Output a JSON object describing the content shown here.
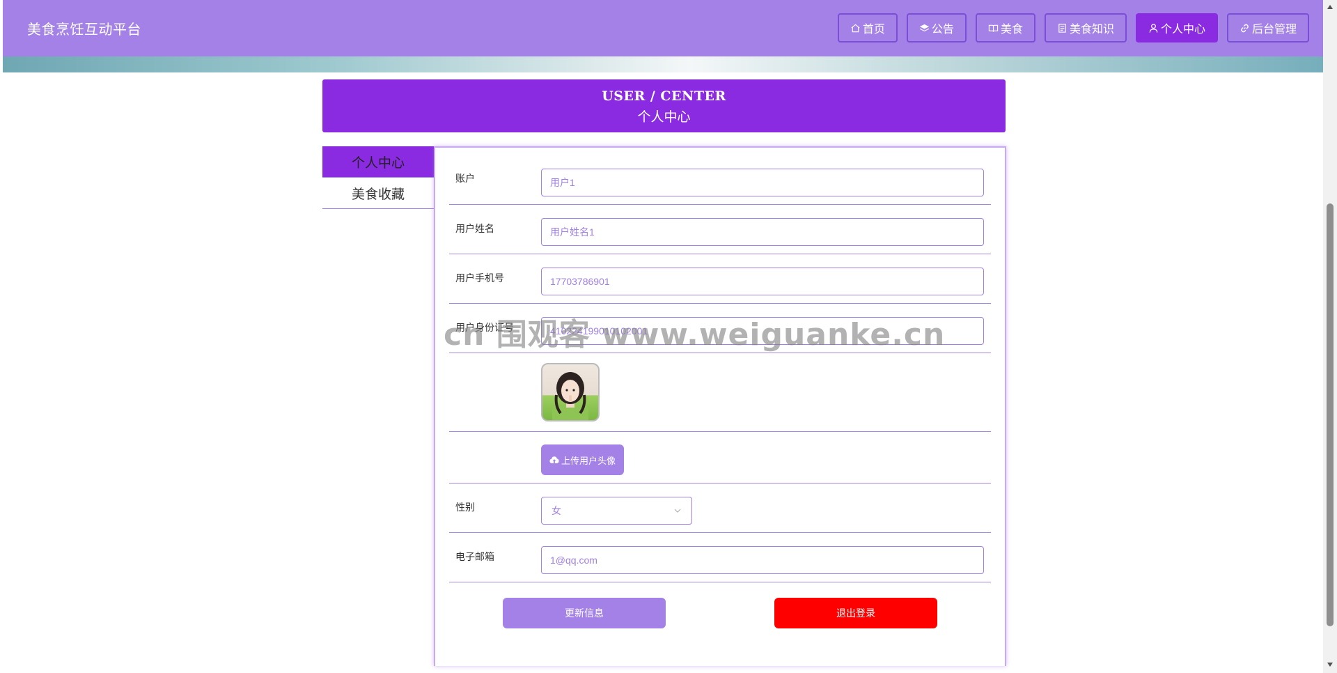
{
  "header": {
    "title": "美食烹饪互动平台",
    "nav": [
      {
        "label": "首页",
        "icon": "home-icon",
        "active": false
      },
      {
        "label": "公告",
        "icon": "layers-icon",
        "active": false
      },
      {
        "label": "美食",
        "icon": "book-icon",
        "active": false
      },
      {
        "label": "美食知识",
        "icon": "document-icon",
        "active": false
      },
      {
        "label": "个人中心",
        "icon": "user-icon",
        "active": true
      },
      {
        "label": "后台管理",
        "icon": "link-icon",
        "active": false
      }
    ]
  },
  "page_title": {
    "en": "USER / CENTER",
    "cn": "个人中心"
  },
  "side_menu": {
    "items": [
      {
        "label": "个人中心",
        "active": true
      },
      {
        "label": "美食收藏",
        "active": false
      }
    ]
  },
  "form": {
    "fields": {
      "account": {
        "label": "账户",
        "value": "用户1"
      },
      "username": {
        "label": "用户姓名",
        "value": "用户姓名1"
      },
      "phone": {
        "label": "用户手机号",
        "value": "17703786901"
      },
      "id_card": {
        "label": "用户身份证号",
        "value": "410224199010102001"
      },
      "gender": {
        "label": "性别",
        "value": "女"
      },
      "email": {
        "label": "电子邮箱",
        "value": "1@qq.com"
      }
    },
    "upload_label": "上传用户头像",
    "update_label": "更新信息",
    "logout_label": "退出登录"
  },
  "watermark": "cn 围观客 www.weiguanke.cn",
  "colors": {
    "header_bg": "#a381e6",
    "accent": "#8a2be2",
    "border": "#a07fe8",
    "logout": "#ff0000"
  }
}
